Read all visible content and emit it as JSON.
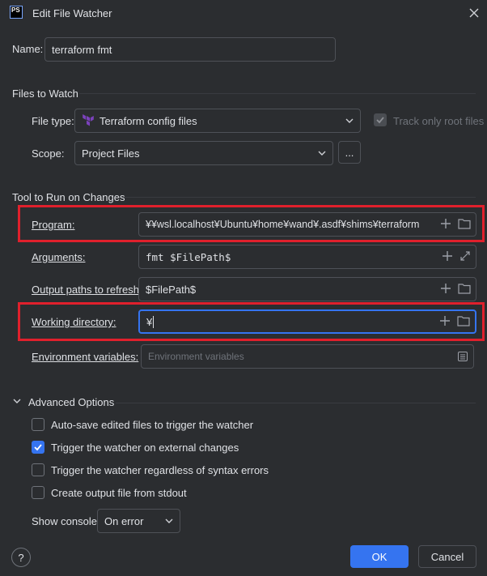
{
  "window": {
    "title": "Edit File Watcher",
    "app_badge": "PS"
  },
  "name": {
    "label": "Name:",
    "value": "terraform fmt"
  },
  "files_to_watch": {
    "section_title": "Files to Watch",
    "file_type_label": "File type:",
    "file_type_value": "Terraform config files",
    "track_only_root_label": "Track only root files",
    "scope_label": "Scope:",
    "scope_value": "Project Files",
    "scope_more_button": "..."
  },
  "tool": {
    "section_title": "Tool to Run on Changes",
    "program_label": "Program:",
    "program_value": "¥¥wsl.localhost¥Ubuntu¥home¥wand¥.asdf¥shims¥terraform",
    "arguments_label": "Arguments:",
    "arguments_value": "fmt $FilePath$",
    "output_paths_label": "Output paths to refresh:",
    "output_paths_value": "$FilePath$",
    "working_dir_label": "Working directory:",
    "working_dir_value": "¥",
    "env_label": "Environment variables:",
    "env_placeholder": "Environment variables"
  },
  "advanced": {
    "section_title": "Advanced Options",
    "options": [
      {
        "label": "Auto-save edited files to trigger the watcher",
        "checked": false
      },
      {
        "label": "Trigger the watcher on external changes",
        "checked": true
      },
      {
        "label": "Trigger the watcher regardless of syntax errors",
        "checked": false
      },
      {
        "label": "Create output file from stdout",
        "checked": false
      }
    ],
    "show_console_label": "Show console:",
    "show_console_value": "On error"
  },
  "footer": {
    "help": "?",
    "ok": "OK",
    "cancel": "Cancel"
  },
  "colors": {
    "background": "#2b2d30",
    "accent": "#3574f0",
    "highlight_box": "#e0202c",
    "terraform_icon": "#7b42bc"
  }
}
